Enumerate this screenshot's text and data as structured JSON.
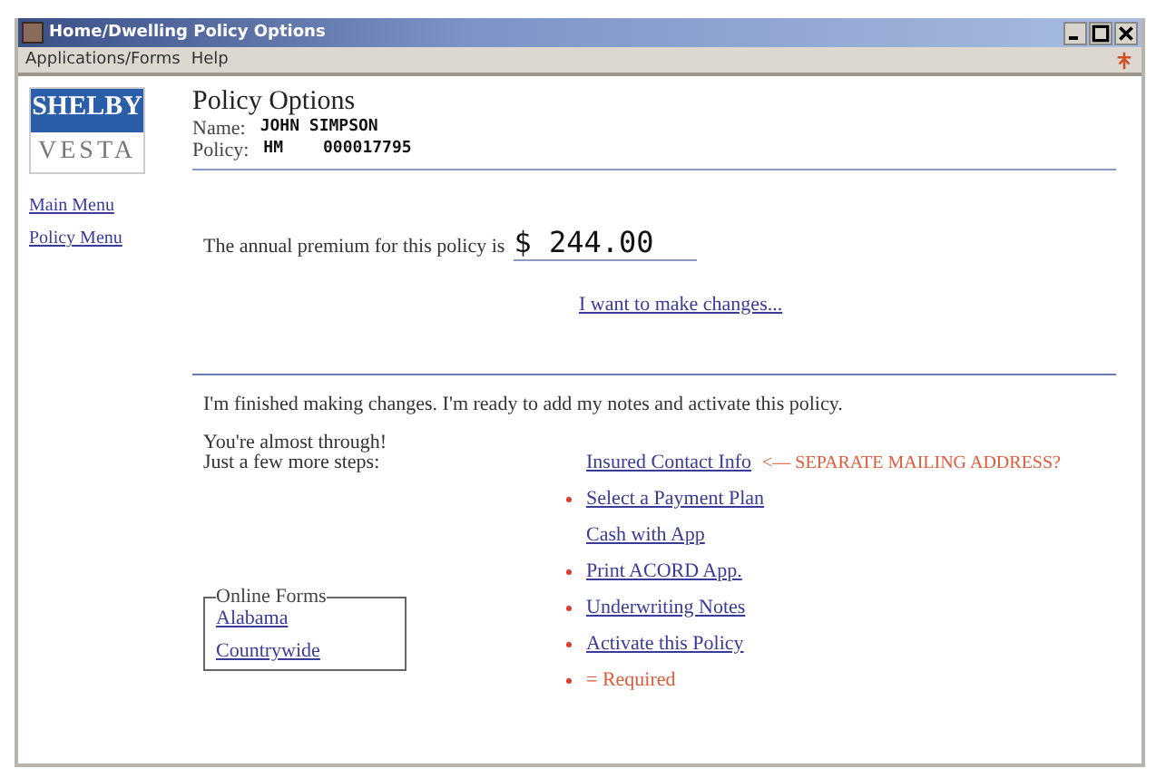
{
  "window": {
    "title": "Home/Dwelling Policy Options"
  },
  "menu": [
    "Applications/Forms",
    "Help"
  ],
  "logo": {
    "top": "SHELBY",
    "bottom": "VESTA"
  },
  "sidebar": {
    "links": [
      "Main Menu",
      "Policy Menu"
    ]
  },
  "header": {
    "title": "Policy Options",
    "name_label": "Name:",
    "name": "JOHN SIMPSON",
    "policy_label": "Policy:",
    "policy_type": "HM",
    "policy_number": "000017795"
  },
  "premium": {
    "label": "The annual premium for this policy is",
    "value": "$ 244.00",
    "link": "I want to make changes..."
  },
  "finished": "I'm finished making changes.  I'm ready to add my notes and activate this policy.",
  "intro": [
    "You're almost through!",
    "Just a few more steps:"
  ],
  "online_forms": {
    "title": "Online Forms",
    "links": [
      "Alabama",
      "Countrywide"
    ]
  },
  "steps": [
    {
      "label": "Insured Contact Info",
      "required": false,
      "note": "<— SEPARATE MAILING ADDRESS?"
    },
    {
      "label": "Select a Payment Plan",
      "required": true
    },
    {
      "label": "Cash with App",
      "required": false
    },
    {
      "label": "Print ACORD App.",
      "required": true
    },
    {
      "label": "Underwriting Notes",
      "required": true
    },
    {
      "label": "Activate this Policy",
      "required": true
    }
  ],
  "legend": "= Required"
}
